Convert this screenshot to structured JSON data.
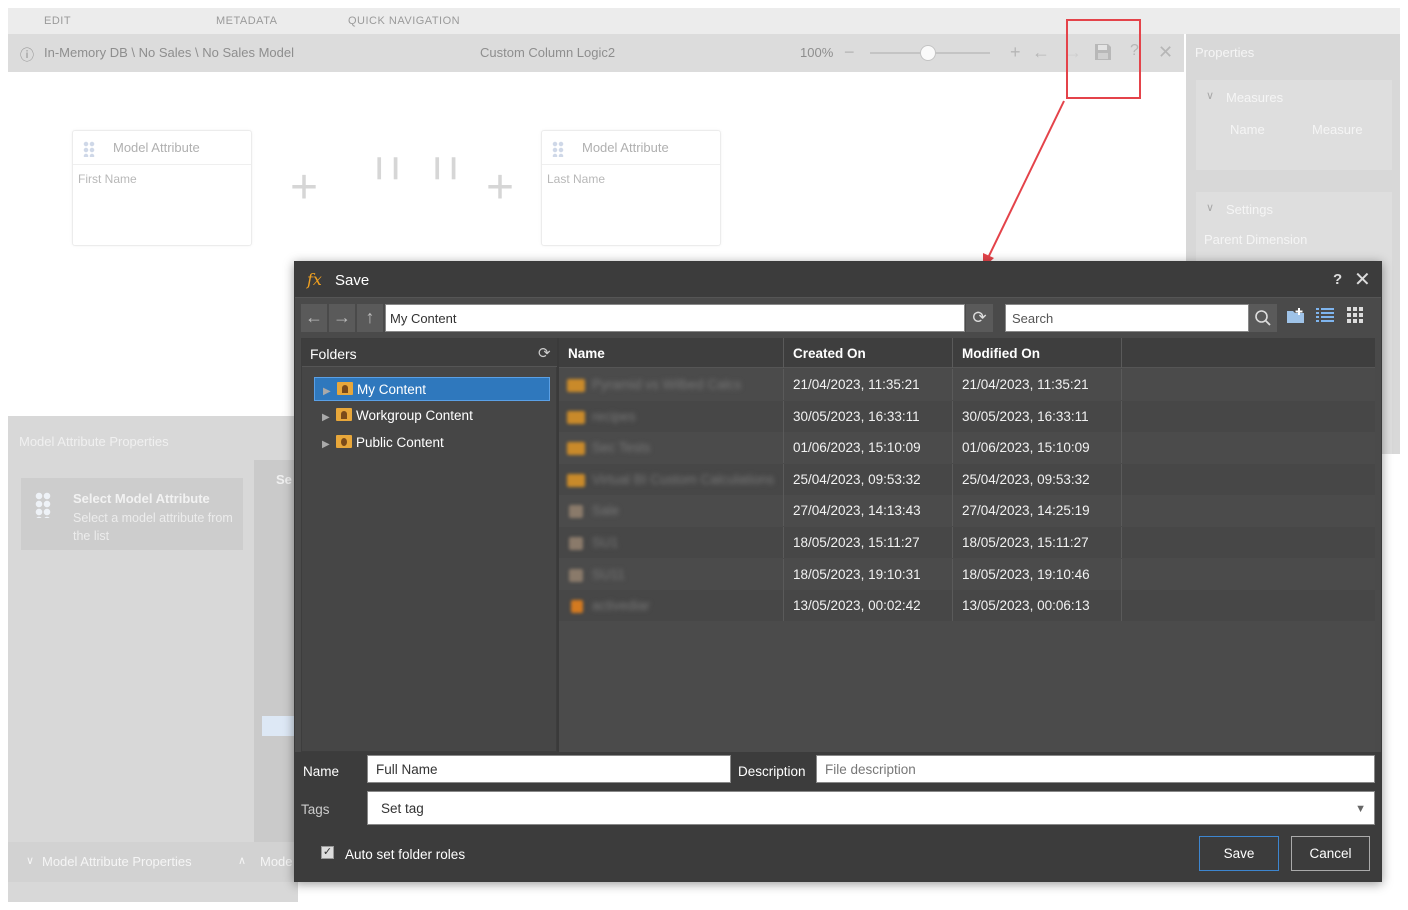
{
  "menu": {
    "edit": "EDIT",
    "metadata": "METADATA",
    "quick_nav": "QUICK NAVIGATION"
  },
  "header": {
    "breadcrumb": "In-Memory DB \\ No Sales \\ No Sales Model",
    "title": "Custom Column Logic2",
    "zoom": "100%"
  },
  "properties": {
    "title": "Properties",
    "measures": "Measures",
    "col_name": "Name",
    "col_measure": "Measure",
    "settings": "Settings",
    "parent_dimension": "Parent Dimension"
  },
  "canvas": {
    "card1": {
      "header": "Model Attribute",
      "value": "First Name"
    },
    "card2": {
      "header": "Model Attribute",
      "value": "Last Name"
    }
  },
  "map_panel": {
    "title": "Model Attribute Properties",
    "select_title": "Select Model Attribute",
    "select_desc": "Select a model attribute from the list",
    "col_header": "Se",
    "bottom_tab1": "Model Attribute Properties",
    "bottom_tab2": "Mode"
  },
  "dialog": {
    "title": "Save",
    "help": "?",
    "path": "My Content",
    "search_placeholder": "Search",
    "folders_header": "Folders",
    "folders": [
      {
        "label": "My Content",
        "selected": true
      },
      {
        "label": "Workgroup Content",
        "selected": false
      },
      {
        "label": "Public Content",
        "selected": false
      }
    ],
    "columns": [
      "Name",
      "Created On",
      "Modified On"
    ],
    "rows": [
      {
        "name": "Pyramid vs Wilbed Calcs",
        "created": "21/04/2023, 11:35:21",
        "modified": "21/04/2023, 11:35:21"
      },
      {
        "name": "recipes",
        "created": "30/05/2023, 16:33:11",
        "modified": "30/05/2023, 16:33:11"
      },
      {
        "name": "Sec Tests",
        "created": "01/06/2023, 15:10:09",
        "modified": "01/06/2023, 15:10:09"
      },
      {
        "name": "Virtual BI Custom Calculations",
        "created": "25/04/2023, 09:53:32",
        "modified": "25/04/2023, 09:53:32"
      },
      {
        "name": "Sale",
        "created": "27/04/2023, 14:13:43",
        "modified": "27/04/2023, 14:25:19"
      },
      {
        "name": "SU1",
        "created": "18/05/2023, 15:11:27",
        "modified": "18/05/2023, 15:11:27"
      },
      {
        "name": "SU11",
        "created": "18/05/2023, 19:10:31",
        "modified": "18/05/2023, 19:10:46"
      },
      {
        "name": "activediar",
        "created": "13/05/2023, 00:02:42",
        "modified": "13/05/2023, 00:06:13"
      }
    ],
    "name_label": "Name",
    "name_value": "Full Name",
    "description_label": "Description",
    "description_placeholder": "File description",
    "tags_label": "Tags",
    "tags_placeholder": "Set tag",
    "auto_roles_label": "Auto set folder roles",
    "save_button": "Save",
    "cancel_button": "Cancel"
  },
  "colors": {
    "accent": "#2f78bd",
    "highlight": "#e4434a",
    "fx": "#f0a020"
  }
}
